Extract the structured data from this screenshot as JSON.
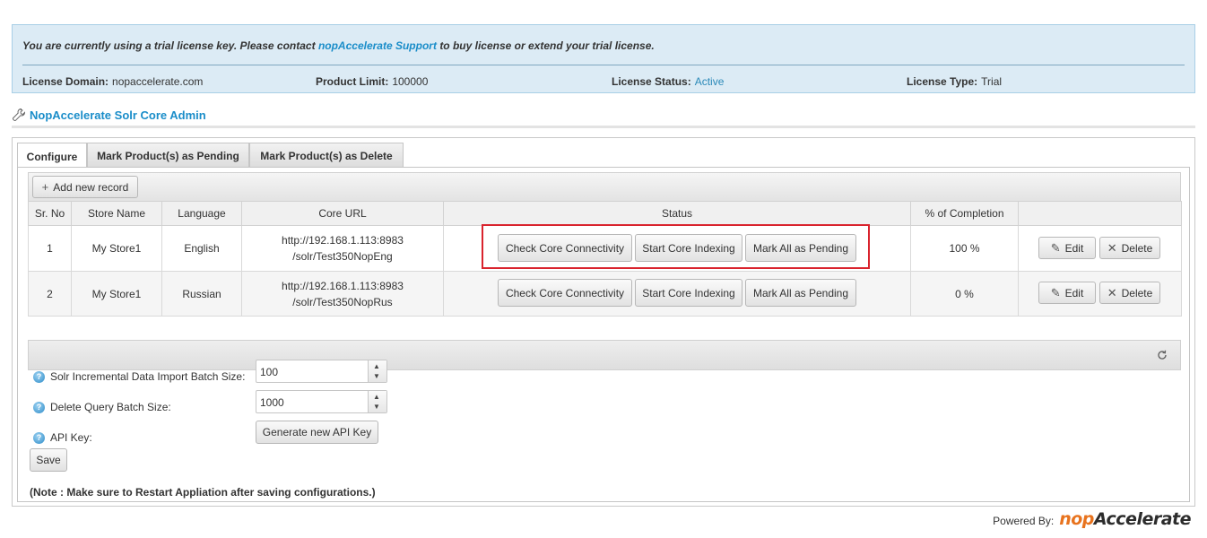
{
  "license": {
    "message_prefix": "You are currently using a trial license key. Please contact",
    "support_link": "nopAccelerate Support",
    "message_suffix": "to buy license or extend your trial license.",
    "domain_label": "License Domain:",
    "domain_value": "nopaccelerate.com",
    "product_limit_label": "Product Limit:",
    "product_limit_value": "100000",
    "status_label": "License Status:",
    "status_value": "Active",
    "type_label": "License Type:",
    "type_value": "Trial"
  },
  "page_title": "NopAccelerate Solr Core Admin",
  "tabs": [
    {
      "label": "Configure",
      "active": true
    },
    {
      "label": "Mark Product(s) as Pending",
      "active": false
    },
    {
      "label": "Mark Product(s) as Delete",
      "active": false
    }
  ],
  "toolbar": {
    "add_label": "Add new record"
  },
  "grid": {
    "columns": [
      "Sr. No",
      "Store Name",
      "Language",
      "Core URL",
      "Status",
      "% of Completion",
      ""
    ],
    "actions": {
      "check": "Check Core Connectivity",
      "start": "Start Core Indexing",
      "mark": "Mark All as Pending",
      "edit": "Edit",
      "delete": "Delete"
    },
    "rows": [
      {
        "sr": "1",
        "store": "My Store1",
        "language": "English",
        "url_line1": "http://192.168.1.113:8983",
        "url_line2": "/solr/Test350NopEng",
        "completion": "100 %"
      },
      {
        "sr": "2",
        "store": "My Store1",
        "language": "Russian",
        "url_line1": "http://192.168.1.113:8983",
        "url_line2": "/solr/Test350NopRus",
        "completion": "0 %"
      }
    ]
  },
  "config": {
    "batch_size_label": "Solr Incremental Data Import Batch Size:",
    "batch_size_value": "100",
    "delete_batch_label": "Delete Query Batch Size:",
    "delete_batch_value": "1000",
    "api_key_label": "API Key:",
    "generate_label": "Generate new API Key",
    "save_label": "Save",
    "note": "(Note : Make sure to Restart Appliation after saving configurations.)"
  },
  "footer": {
    "powered_by": "Powered By:",
    "logo_prefix": "nop",
    "logo_suffix": "Accelerate"
  },
  "colors": {
    "accent": "#1a8dc9",
    "banner_bg": "#dcebf5",
    "highlight": "#d9232d",
    "logo_orange": "#e8731e"
  }
}
